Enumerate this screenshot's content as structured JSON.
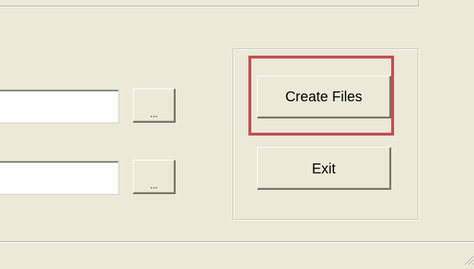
{
  "fields": {
    "file_path_1": "",
    "file_path_2": ""
  },
  "buttons": {
    "browse_1_label": "...",
    "browse_2_label": "...",
    "create_files_label": "Create Files",
    "exit_label": "Exit"
  },
  "colors": {
    "window_background": "#ece9d8",
    "highlight": "#c24f4f"
  },
  "icons": {
    "resize_grip": "resize-grip-icon"
  }
}
